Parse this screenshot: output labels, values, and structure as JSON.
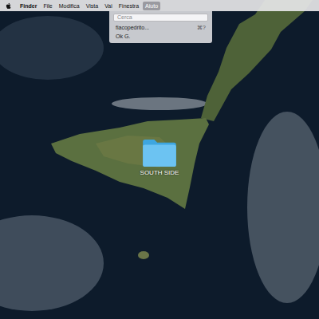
{
  "menu_bar": {
    "items": [
      {
        "label": "Finder",
        "selected": false
      },
      {
        "label": "File",
        "selected": false
      },
      {
        "label": "Modifica",
        "selected": false
      },
      {
        "label": "Vista",
        "selected": false
      },
      {
        "label": "Vai",
        "selected": false
      },
      {
        "label": "Finestra",
        "selected": false
      },
      {
        "label": "Aiuto",
        "selected": true
      }
    ]
  },
  "help_menu": {
    "search_placeholder": "Cerca",
    "items": [
      {
        "label": "fiacopedrito...",
        "shortcut": "⌘?"
      },
      {
        "label": "Ok G."
      }
    ]
  },
  "desktop": {
    "folder": {
      "label": "SOUTH SIDE"
    }
  }
}
